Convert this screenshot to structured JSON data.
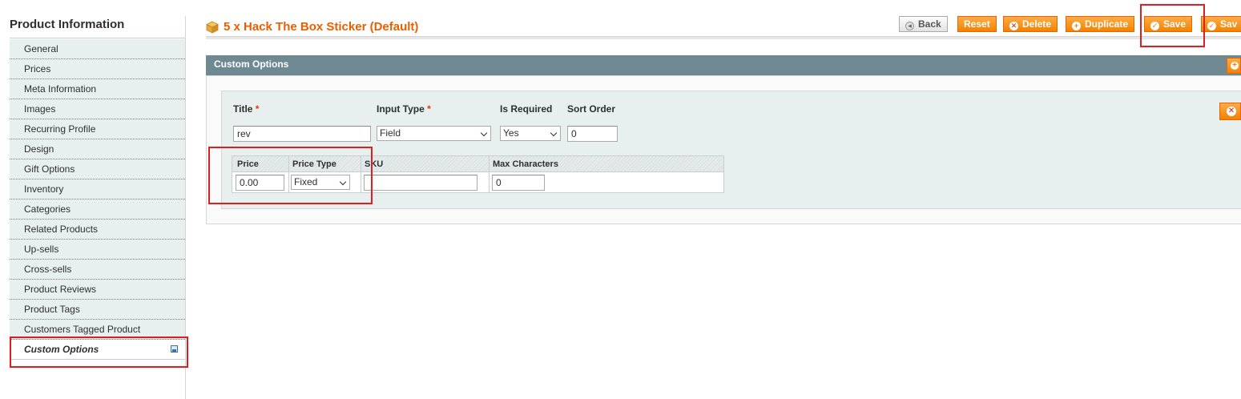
{
  "sidebar": {
    "title": "Product Information",
    "items": [
      {
        "label": "General"
      },
      {
        "label": "Prices"
      },
      {
        "label": "Meta Information"
      },
      {
        "label": "Images"
      },
      {
        "label": "Recurring Profile"
      },
      {
        "label": "Design"
      },
      {
        "label": "Gift Options"
      },
      {
        "label": "Inventory"
      },
      {
        "label": "Categories"
      },
      {
        "label": "Related Products"
      },
      {
        "label": "Up-sells"
      },
      {
        "label": "Cross-sells"
      },
      {
        "label": "Product Reviews"
      },
      {
        "label": "Product Tags"
      },
      {
        "label": "Customers Tagged Product"
      },
      {
        "label": "Custom Options",
        "active": true
      }
    ]
  },
  "header": {
    "title": "5 x Hack The Box Sticker (Default)",
    "buttons": {
      "back": "Back",
      "reset": "Reset",
      "delete": "Delete",
      "duplicate": "Duplicate",
      "save": "Save",
      "save_and_continue": "Sav"
    }
  },
  "custom_options": {
    "section_title": "Custom Options",
    "option": {
      "title_label": "Title",
      "input_type_label": "Input Type",
      "is_required_label": "Is Required",
      "sort_order_label": "Sort Order",
      "required_marker": "*",
      "title_value": "rev",
      "input_type_value": "Field",
      "is_required_value": "Yes",
      "sort_order_value": "0"
    },
    "price_table": {
      "headers": [
        "Price",
        "Price Type",
        "SKU",
        "Max Characters"
      ],
      "price_value": "0.00",
      "price_type_value": "Fixed",
      "sku_value": "",
      "max_characters_value": "0"
    }
  },
  "colors": {
    "accent": "#eb5e00",
    "button_orange": "#f18200",
    "panel_header": "#6f8992",
    "annotation_red": "#dd1f1f"
  },
  "icons": [
    "box-icon",
    "back-arrow-icon",
    "delete-circle-icon",
    "plus-circle-icon",
    "check-circle-icon",
    "save-indicator-icon"
  ]
}
